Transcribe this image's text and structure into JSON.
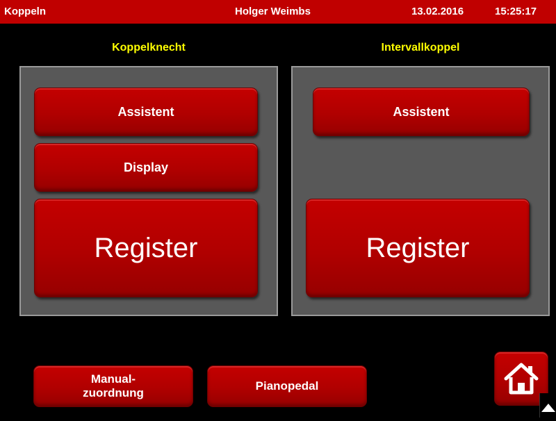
{
  "header": {
    "title": "Koppeln",
    "user": "Holger Weimbs",
    "date": "13.02.2016",
    "time": "15:25:17"
  },
  "left_panel": {
    "title": "Koppelknecht",
    "assistant_label": "Assistent",
    "display_label": "Display",
    "register_label": "Register"
  },
  "right_panel": {
    "title": "Intervallkoppel",
    "assistant_label": "Assistent",
    "register_label": "Register"
  },
  "footer": {
    "manual_line1": "Manual-",
    "manual_line2": "zuordnung",
    "pianopedal_label": "Pianopedal"
  },
  "icons": {
    "home": "home-icon",
    "scroll": "triangle-up-icon"
  },
  "colors": {
    "header_bg": "#c00000",
    "button_red": "#b00000",
    "panel_gray": "#585858",
    "title_yellow": "#ffff00",
    "background": "#000000"
  }
}
